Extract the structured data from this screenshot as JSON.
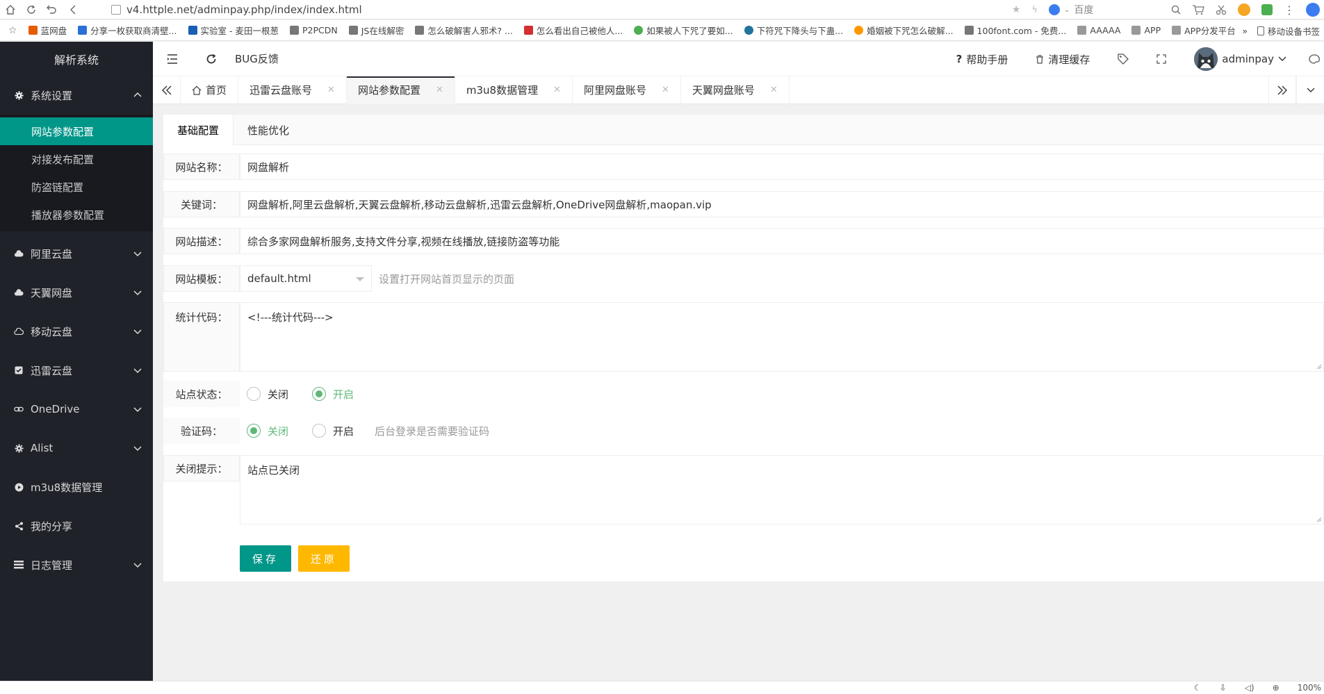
{
  "browser": {
    "url": "v4.httple.net/adminpay.php/index/index.html",
    "search_engine": "百度",
    "bookmarks": [
      "蓝网盘",
      "分享一枚获取商清壁...",
      "实验室 - 麦田一根葱",
      "P2PCDN",
      "JS在线解密",
      "怎么破解害人邪术? ...",
      "怎么看出自己被他人...",
      "如果被人下咒了要如...",
      "下符咒下降头与下蛊...",
      "婚姻被下咒怎么破解...",
      "100font.com - 免费...",
      "AAAAA",
      "APP",
      "APP分发平台"
    ],
    "bookmarks_more": "»",
    "mobile_bookmarks": "移动设备书签",
    "zoom": "100%"
  },
  "sidebar": {
    "logo": "解析系统",
    "groups": [
      {
        "label": "系统设置",
        "icon": "gear-icon",
        "expanded": true,
        "children": [
          "网站参数配置",
          "对接发布配置",
          "防盗链配置",
          "播放器参数配置"
        ]
      },
      {
        "label": "阿里云盘",
        "icon": "cloud-icon"
      },
      {
        "label": "天翼网盘",
        "icon": "cloud-icon"
      },
      {
        "label": "移动云盘",
        "icon": "cloud-outline-icon"
      },
      {
        "label": "迅雷云盘",
        "icon": "checkbox-icon"
      },
      {
        "label": "OneDrive",
        "icon": "link-icon"
      },
      {
        "label": "Alist",
        "icon": "gear-icon"
      },
      {
        "label": "m3u8数据管理",
        "icon": "play-icon"
      },
      {
        "label": "我的分享",
        "icon": "share-icon"
      },
      {
        "label": "日志管理",
        "icon": "list-icon"
      }
    ]
  },
  "header": {
    "bug_feedback": "BUG反馈",
    "help": "帮助手册",
    "clear_cache": "清理缓存",
    "username": "adminpay"
  },
  "tabs": {
    "home": "首页",
    "items": [
      "迅雷云盘账号",
      "网站参数配置",
      "m3u8数据管理",
      "阿里网盘账号",
      "天翼网盘账号"
    ],
    "active_index": 1
  },
  "form": {
    "tabs": [
      "基础配置",
      "性能优化"
    ],
    "site_name_label": "网站名称：",
    "site_name": "网盘解析",
    "keywords_label": "关键词：",
    "keywords": "网盘解析,阿里云盘解析,天翼云盘解析,移动云盘解析,迅雷云盘解析,OneDrive网盘解析,maopan.vip",
    "description_label": "网站描述：",
    "description": "综合多家网盘解析服务,支持文件分享,视频在线播放,链接防盗等功能",
    "template_label": "网站模板：",
    "template": "default.html",
    "template_hint": "设置打开网站首页显示的页面",
    "stats_label": "统计代码：",
    "stats_code": "<!---统计代码--->",
    "status_label": "站点状态：",
    "status_off": "关闭",
    "status_on": "开启",
    "captcha_label": "验证码：",
    "captcha_off": "关闭",
    "captcha_on": "开启",
    "captcha_hint": "后台登录是否需要验证码",
    "closed_tip_label": "关闭提示：",
    "closed_tip": "站点已关闭",
    "save_button": "保存",
    "reset_button": "还原"
  },
  "colors": {
    "sidebar_bg": "#20222a",
    "accent": "#009688",
    "radio_checked": "#5fb878",
    "reset": "#ffb800"
  }
}
